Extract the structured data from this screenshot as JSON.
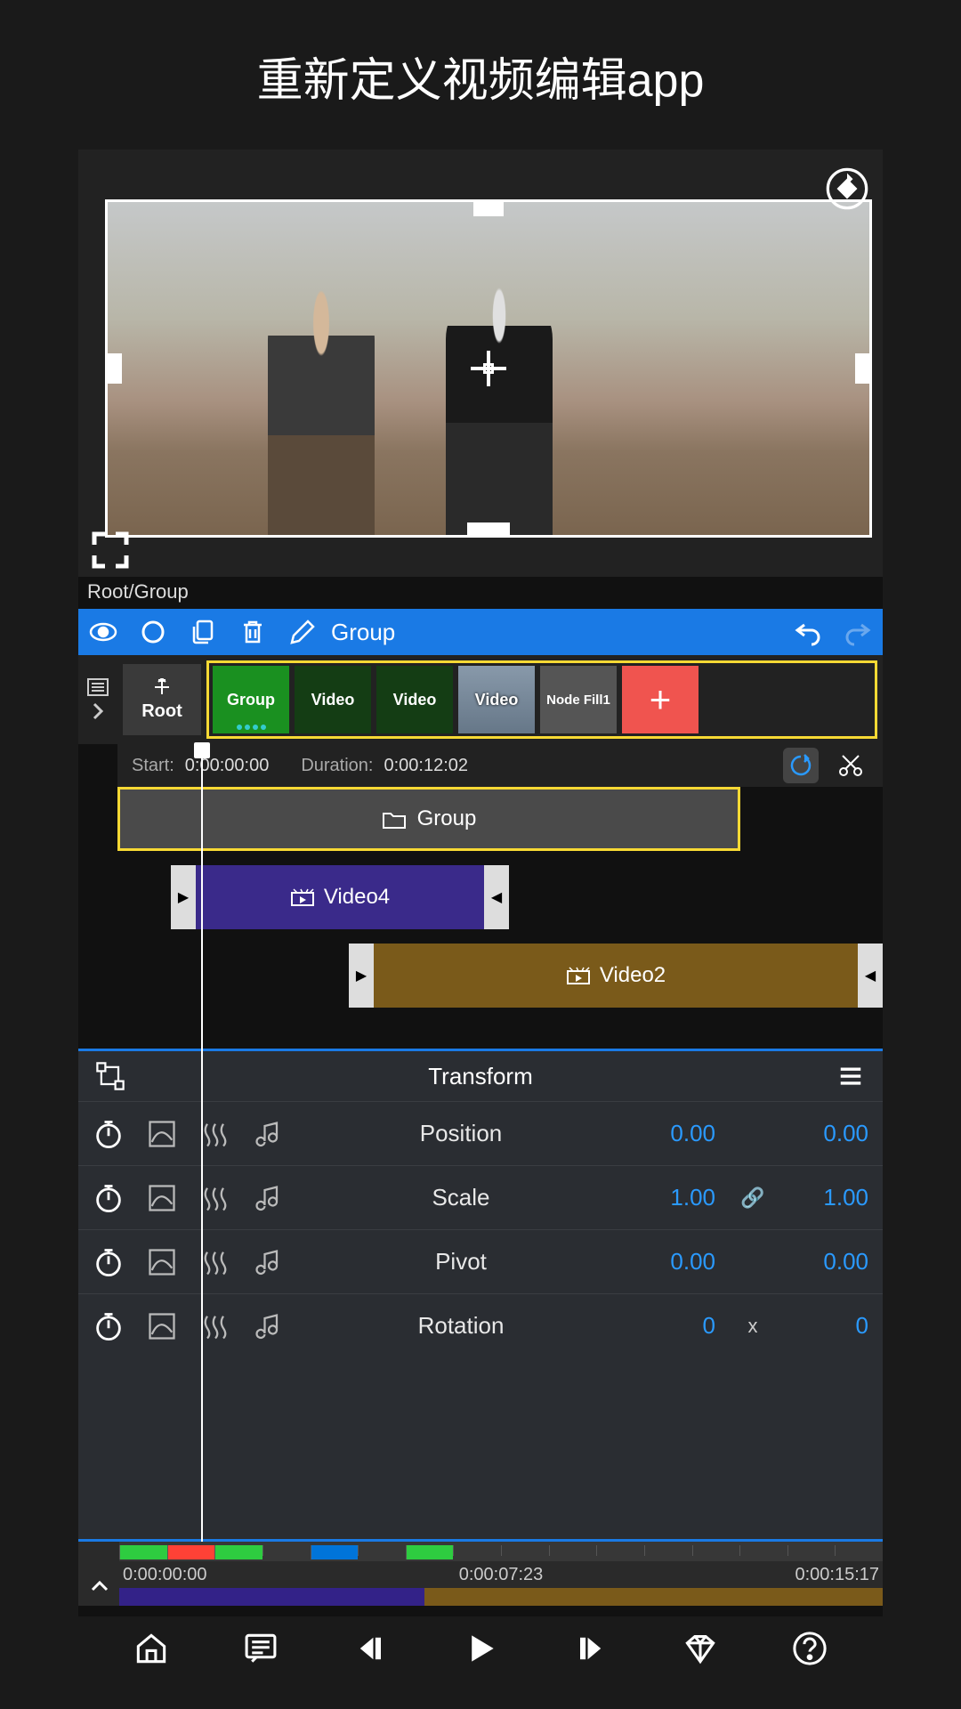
{
  "title": "重新定义视频编辑app",
  "breadcrumb": "Root/Group",
  "toolbar": {
    "group_label": "Group"
  },
  "nodes": {
    "root": "Root",
    "items": [
      "Group",
      "Video",
      "Video",
      "Video",
      "Node Fill1"
    ],
    "add": "+"
  },
  "timing": {
    "start_label": "Start:",
    "start_value": "0:00:00:00",
    "duration_label": "Duration:",
    "duration_value": "0:00:12:02"
  },
  "timeline": {
    "group": "Group",
    "video4": "Video4",
    "video2": "Video2"
  },
  "transform": {
    "title": "Transform",
    "rows": [
      {
        "label": "Position",
        "v1": "0.00",
        "v2": "0.00",
        "link": ""
      },
      {
        "label": "Scale",
        "v1": "1.00",
        "v2": "1.00",
        "link": "link"
      },
      {
        "label": "Pivot",
        "v1": "0.00",
        "v2": "0.00",
        "link": ""
      },
      {
        "label": "Rotation",
        "v1": "0",
        "v2": "0",
        "link": "x"
      }
    ]
  },
  "ruler": {
    "t1": "0:00:00:00",
    "t2": "0:00:07:23",
    "t3": "0:00:15:17"
  },
  "colors": {
    "accent": "#1a7ae5",
    "highlight": "#f7d934",
    "value": "#2a9aff"
  }
}
